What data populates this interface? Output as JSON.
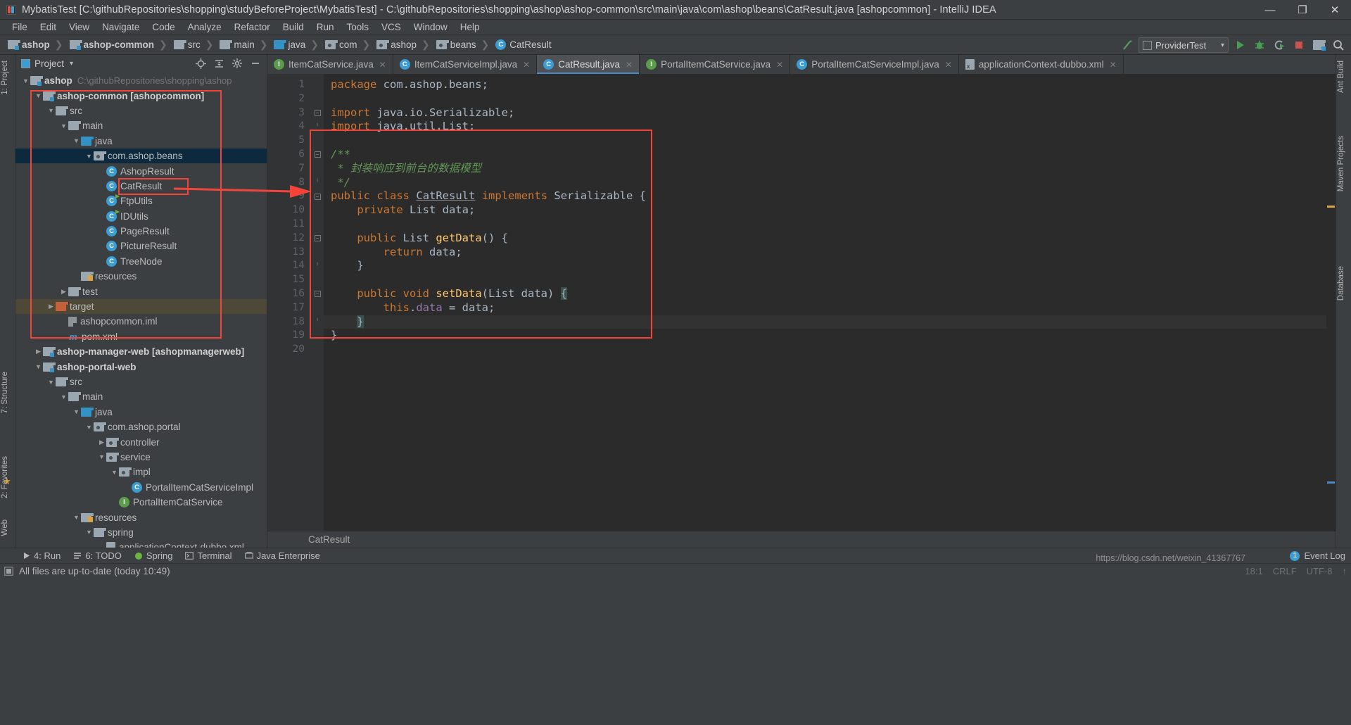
{
  "window": {
    "title": "MybatisTest [C:\\githubRepositories\\shopping\\studyBeforeProject\\MybatisTest] - C:\\githubRepositories\\shopping\\ashop\\ashop-common\\src\\main\\java\\com\\ashop\\beans\\CatResult.java [ashopcommon] - IntelliJ IDEA",
    "minimize": "—",
    "maximize": "❐",
    "close": "✕"
  },
  "menu": [
    "File",
    "Edit",
    "View",
    "Navigate",
    "Code",
    "Analyze",
    "Refactor",
    "Build",
    "Run",
    "Tools",
    "VCS",
    "Window",
    "Help"
  ],
  "breadcrumbs": [
    {
      "label": "ashop",
      "icon": "module-folder-icon",
      "bold": true
    },
    {
      "label": "ashop-common",
      "icon": "module-folder-icon",
      "bold": true
    },
    {
      "label": "src",
      "icon": "folder-icon",
      "bold": false
    },
    {
      "label": "main",
      "icon": "folder-icon",
      "bold": false
    },
    {
      "label": "java",
      "icon": "source-folder-icon",
      "bold": false
    },
    {
      "label": "com",
      "icon": "package-icon",
      "bold": false
    },
    {
      "label": "ashop",
      "icon": "package-icon",
      "bold": false
    },
    {
      "label": "beans",
      "icon": "package-icon",
      "bold": false
    },
    {
      "label": "CatResult",
      "icon": "class-icon",
      "bold": false
    }
  ],
  "toolbar": {
    "run_config": "ProviderTest",
    "dropdown_caret": "▾"
  },
  "project_panel": {
    "title": "Project",
    "caret": "▾",
    "tree": [
      {
        "depth": 0,
        "arrow": "▼",
        "label": "ashop",
        "bold": true,
        "path": "C:\\githubRepositories\\shopping\\ashop",
        "icon": "module-folder-icon"
      },
      {
        "depth": 1,
        "arrow": "▼",
        "label": "ashop-common [ashopcommon]",
        "bold": true,
        "path": "",
        "icon": "module-folder-icon"
      },
      {
        "depth": 2,
        "arrow": "▼",
        "label": "src",
        "bold": false,
        "path": "",
        "icon": "folder-icon"
      },
      {
        "depth": 3,
        "arrow": "▼",
        "label": "main",
        "bold": false,
        "path": "",
        "icon": "folder-icon"
      },
      {
        "depth": 4,
        "arrow": "▼",
        "label": "java",
        "bold": false,
        "path": "",
        "icon": "source-folder-icon"
      },
      {
        "depth": 5,
        "arrow": "▼",
        "label": "com.ashop.beans",
        "bold": false,
        "path": "",
        "icon": "package-icon",
        "selected": true
      },
      {
        "depth": 6,
        "arrow": "",
        "label": "AshopResult",
        "bold": false,
        "path": "",
        "icon": "class-icon"
      },
      {
        "depth": 6,
        "arrow": "",
        "label": "CatResult",
        "bold": false,
        "path": "",
        "icon": "class-icon",
        "highlight_box": true
      },
      {
        "depth": 6,
        "arrow": "",
        "label": "FtpUtils",
        "bold": false,
        "path": "",
        "icon": "class-runnable-icon"
      },
      {
        "depth": 6,
        "arrow": "",
        "label": "IDUtils",
        "bold": false,
        "path": "",
        "icon": "class-runnable-icon"
      },
      {
        "depth": 6,
        "arrow": "",
        "label": "PageResult",
        "bold": false,
        "path": "",
        "icon": "class-icon"
      },
      {
        "depth": 6,
        "arrow": "",
        "label": "PictureResult",
        "bold": false,
        "path": "",
        "icon": "class-icon"
      },
      {
        "depth": 6,
        "arrow": "",
        "label": "TreeNode",
        "bold": false,
        "path": "",
        "icon": "class-icon"
      },
      {
        "depth": 4,
        "arrow": "",
        "label": "resources",
        "bold": false,
        "path": "",
        "icon": "resources-folder-icon"
      },
      {
        "depth": 3,
        "arrow": "▶",
        "label": "test",
        "bold": false,
        "path": "",
        "icon": "folder-icon"
      },
      {
        "depth": 2,
        "arrow": "▶",
        "label": "target",
        "bold": false,
        "path": "",
        "icon": "target-folder-icon",
        "row_highlight": true
      },
      {
        "depth": 3,
        "arrow": "",
        "label": "ashopcommon.iml",
        "bold": false,
        "path": "",
        "icon": "iml-file-icon"
      },
      {
        "depth": 3,
        "arrow": "",
        "label": "pom.xml",
        "bold": false,
        "path": "",
        "icon": "maven-file-icon"
      },
      {
        "depth": 1,
        "arrow": "▶",
        "label": "ashop-manager-web [ashopmanagerweb]",
        "bold": true,
        "path": "",
        "icon": "module-folder-icon"
      },
      {
        "depth": 1,
        "arrow": "▼",
        "label": "ashop-portal-web",
        "bold": true,
        "path": "",
        "icon": "module-folder-icon"
      },
      {
        "depth": 2,
        "arrow": "▼",
        "label": "src",
        "bold": false,
        "path": "",
        "icon": "folder-icon"
      },
      {
        "depth": 3,
        "arrow": "▼",
        "label": "main",
        "bold": false,
        "path": "",
        "icon": "folder-icon"
      },
      {
        "depth": 4,
        "arrow": "▼",
        "label": "java",
        "bold": false,
        "path": "",
        "icon": "source-folder-icon"
      },
      {
        "depth": 5,
        "arrow": "▼",
        "label": "com.ashop.portal",
        "bold": false,
        "path": "",
        "icon": "package-icon"
      },
      {
        "depth": 6,
        "arrow": "▶",
        "label": "controller",
        "bold": false,
        "path": "",
        "icon": "package-icon"
      },
      {
        "depth": 6,
        "arrow": "▼",
        "label": "service",
        "bold": false,
        "path": "",
        "icon": "package-icon"
      },
      {
        "depth": 7,
        "arrow": "▼",
        "label": "impl",
        "bold": false,
        "path": "",
        "icon": "package-icon"
      },
      {
        "depth": 8,
        "arrow": "",
        "label": "PortalItemCatServiceImpl",
        "bold": false,
        "path": "",
        "icon": "class-icon"
      },
      {
        "depth": 7,
        "arrow": "",
        "label": "PortalItemCatService",
        "bold": false,
        "path": "",
        "icon": "interface-icon"
      },
      {
        "depth": 4,
        "arrow": "▼",
        "label": "resources",
        "bold": false,
        "path": "",
        "icon": "resources-folder-icon"
      },
      {
        "depth": 5,
        "arrow": "▼",
        "label": "spring",
        "bold": false,
        "path": "",
        "icon": "folder-icon"
      },
      {
        "depth": 6,
        "arrow": "",
        "label": "applicationContext-dubbo.xml",
        "bold": false,
        "path": "",
        "icon": "xml-file-icon"
      }
    ]
  },
  "editor_tabs": [
    {
      "label": "ItemCatService.java",
      "icon": "interface-icon",
      "active": false,
      "close": "✕"
    },
    {
      "label": "ItemCatServiceImpl.java",
      "icon": "class-icon",
      "active": false,
      "close": "✕"
    },
    {
      "label": "CatResult.java",
      "icon": "class-icon",
      "active": true,
      "close": "✕"
    },
    {
      "label": "PortalItemCatService.java",
      "icon": "interface-icon",
      "active": false,
      "close": "✕"
    },
    {
      "label": "PortalItemCatServiceImpl.java",
      "icon": "class-icon",
      "active": false,
      "close": "✕"
    },
    {
      "label": "applicationContext-dubbo.xml",
      "icon": "xml-file-icon",
      "active": false,
      "close": "✕"
    }
  ],
  "code": {
    "line_numbers": [
      "1",
      "2",
      "3",
      "4",
      "5",
      "6",
      "7",
      "8",
      "9",
      "10",
      "11",
      "12",
      "13",
      "14",
      "15",
      "16",
      "17",
      "18",
      "19",
      "20"
    ],
    "lines": [
      "package com.ashop.beans;",
      "",
      "import java.io.Serializable;",
      "import java.util.List;",
      "",
      "/**",
      " * 封装响应到前台的数据模型",
      " */",
      "public class CatResult implements Serializable {",
      "    private List data;",
      "",
      "    public List getData() {",
      "        return data;",
      "    }",
      "",
      "    public void setData(List data) {",
      "        this.data = data;",
      "    }",
      "}",
      ""
    ]
  },
  "editor_status": "CatResult",
  "bottom_toolwindows": [
    {
      "label": "4: Run",
      "icon": "run-icon"
    },
    {
      "label": "6: TODO",
      "icon": "todo-icon"
    },
    {
      "label": "Spring",
      "icon": "spring-icon"
    },
    {
      "label": "Terminal",
      "icon": "terminal-icon"
    },
    {
      "label": "Java Enterprise",
      "icon": "java-enterprise-icon"
    }
  ],
  "event_log": {
    "label": "Event Log",
    "count": "1"
  },
  "left_toolwindows": [
    {
      "label": "1: Project"
    },
    {
      "label": "7: Structure"
    },
    {
      "label": "2: Favorites"
    },
    {
      "label": "Web"
    }
  ],
  "right_toolwindows": [
    {
      "label": "Ant Build"
    },
    {
      "label": "Maven Projects"
    },
    {
      "label": "Database"
    }
  ],
  "statusbar": {
    "message": "All files are up-to-date (today 10:49)",
    "right": [
      "18:1",
      "CRLF",
      "UTF-8",
      "↑"
    ]
  },
  "watermark": "https://blog.csdn.net/weixin_41367767",
  "colors": {
    "accent": "#4a88c7",
    "annotation_red": "#f4443a",
    "keyword": "#cc7832",
    "comment": "#629755",
    "method": "#ffc66d",
    "field": "#9876aa",
    "background": "#2b2b2b",
    "panel": "#3c3f41"
  }
}
